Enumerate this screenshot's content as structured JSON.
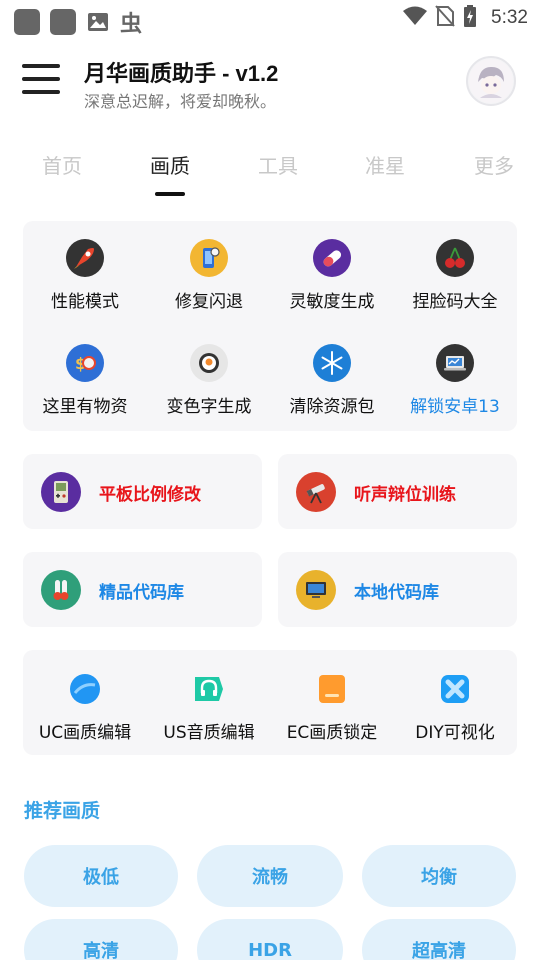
{
  "status_bar": {
    "time": "5:32",
    "bug_glyph": "虫"
  },
  "header": {
    "title": "月华画质助手 - v1.2",
    "subtitle": "深意总迟解，将爱却晚秋。"
  },
  "tabs": [
    {
      "label": "首页"
    },
    {
      "label": "画质"
    },
    {
      "label": "工具"
    },
    {
      "label": "准星"
    },
    {
      "label": "更多"
    }
  ],
  "grid1": [
    {
      "label": "性能模式",
      "icon": "rocket-icon"
    },
    {
      "label": "修复闪退",
      "icon": "phone-gear-icon"
    },
    {
      "label": "灵敏度生成",
      "icon": "capsule-icon"
    },
    {
      "label": "捏脸码大全",
      "icon": "cherry-icon"
    },
    {
      "label": "这里有物资",
      "icon": "money-icon"
    },
    {
      "label": "变色字生成",
      "icon": "sushi-icon"
    },
    {
      "label": "清除资源包",
      "icon": "snowflake-icon"
    },
    {
      "label": "解锁安卓13",
      "icon": "laptop-icon"
    }
  ],
  "half_cards": [
    {
      "label": "平板比例修改",
      "icon": "gameboy-icon"
    },
    {
      "label": "听声辩位训练",
      "icon": "telescope-icon"
    },
    {
      "label": "精品代码库",
      "icon": "thermometer-icon"
    },
    {
      "label": "本地代码库",
      "icon": "monitor-icon"
    }
  ],
  "grid2": [
    {
      "label": "UC画质编辑",
      "icon": "blue-circle-icon"
    },
    {
      "label": "US音质编辑",
      "icon": "headphones-icon"
    },
    {
      "label": "EC画质锁定",
      "icon": "orange-file-icon"
    },
    {
      "label": "DIY可视化",
      "icon": "blue-x-icon"
    }
  ],
  "recommend": {
    "title": "推荐画质",
    "options": [
      "极低",
      "流畅",
      "均衡",
      "高清",
      "HDR",
      "超高清"
    ]
  },
  "colors": {
    "accent_blue": "#1e88e5",
    "light_blue": "#3aa3e6",
    "pill_bg": "#e2f1fb",
    "red": "#e8151b"
  }
}
